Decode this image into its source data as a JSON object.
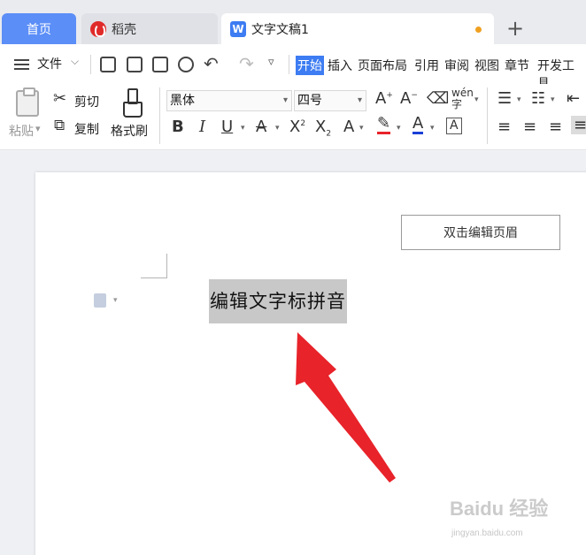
{
  "tabs": {
    "home": "首页",
    "daoke": "稻壳",
    "doc": "文字文稿1",
    "add": "+"
  },
  "toolbar1": {
    "file_label": "文件",
    "ribbon_tabs": [
      "开始",
      "插入",
      "页面布局",
      "引用",
      "审阅",
      "视图",
      "章节",
      "开发工具"
    ]
  },
  "toolbar2": {
    "paste_label": "粘贴",
    "cut_label": "剪切",
    "copy_label": "复制",
    "format_brush_label": "格式刷",
    "font_name": "黑体",
    "font_size": "四号",
    "pinyin_glyph": "wén"
  },
  "document": {
    "header_button": "双击编辑页眉",
    "selected_text": "编辑文字标拼音"
  },
  "watermark": {
    "brand": "Baidu 经验",
    "url": "jingyan.baidu.com"
  },
  "colors": {
    "accent": "#3d7cf2",
    "home_tab": "#5b8ef7",
    "arrow": "#e8232a",
    "selection": "#c8c8c8"
  }
}
